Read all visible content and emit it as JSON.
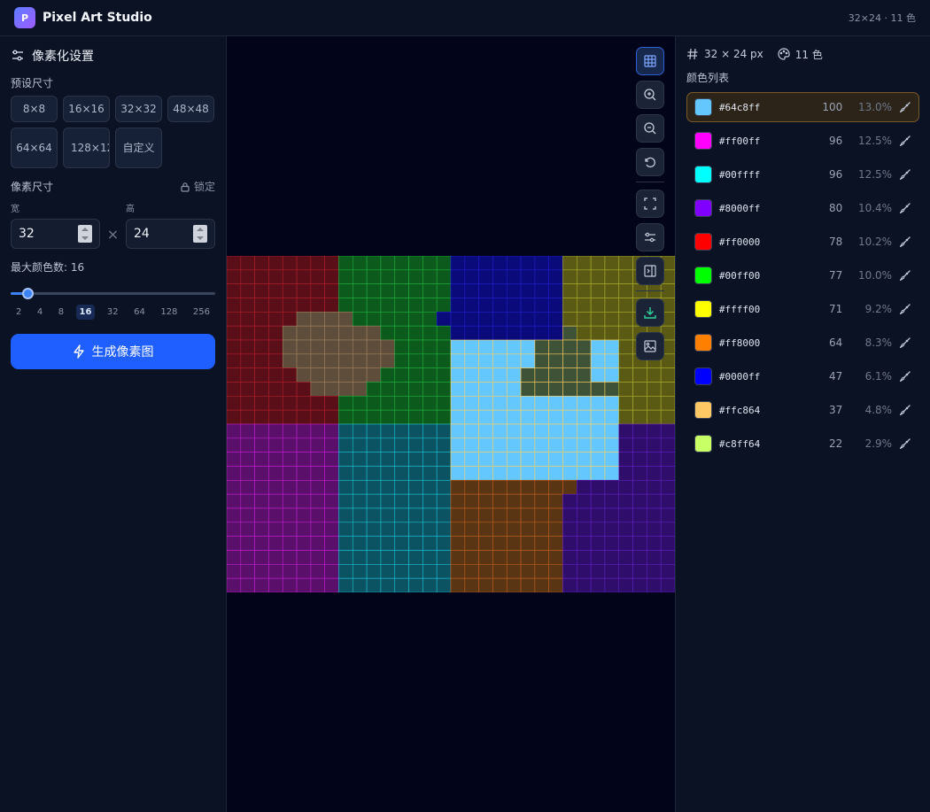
{
  "header": {
    "logo_letter": "P",
    "title": "Pixel Art Studio",
    "meta": "32×24 · 11 色"
  },
  "left": {
    "title": "像素化设置",
    "preset_label": "预设尺寸",
    "presets": [
      "8×8",
      "16×16",
      "32×32",
      "48×48",
      "64×64",
      "128×128",
      "自定义"
    ],
    "pixel_size_label": "像素尺寸",
    "lock_label": "锁定",
    "width_label": "宽",
    "height_label": "高",
    "width_value": "32",
    "height_value": "24",
    "times": "×",
    "max_colors_label": "最大颜色数: 16",
    "ticks": [
      "2",
      "4",
      "8",
      "16",
      "32",
      "64",
      "128",
      "256"
    ],
    "generate_label": "生成像素图"
  },
  "canvas": {
    "cols": 32,
    "rows": 24,
    "palette": {
      "r": "#5a0e18",
      "g": "#0c5a1c",
      "b": "#0a0a7a",
      "y": "#5a5a14",
      "m": "#5a0f6a",
      "c": "#0b5262",
      "o": "#5a3514",
      "p": "#2e0e6a",
      "k": "#5e4d3a",
      "l": "#64c8ff",
      "d": "#3e5238"
    },
    "grid_colors": {
      "r": "#b02030",
      "g": "#22b040",
      "b": "#2020c8",
      "y": "#b0b030",
      "m": "#c020d0",
      "c": "#20c0d0",
      "o": "#c06020",
      "p": "#6020c0",
      "k": "#a08060",
      "l": "#ffd060",
      "d": "#ffd060"
    },
    "rows_data": [
      "rrrrrrrrggggggggbbbbbbbbyyyyyyyy",
      "rrrrrrrrggggggggbbbbbbbbyyyyyyyy",
      "rrrrrrrrggggggggbbbbbbbbyyyyyyyy",
      "rrrrrrrrggggggggbbbbbbbbyyyyyyyy",
      "rrrrrkkkkggggggbbbbbbbbbyyyyyyyy",
      "rrrrkkkkkkkgggggbbbbbbbbdyyyyyyy",
      "rrrrkkkkkkkkggggllllllddddllyyyy",
      "rrrrkkkkkkkkggggllllllddddllyyyy",
      "rrrrrkkkkkkgggggllllldddddllyyyy",
      "rrrrrrkkkkggggggllllldddddddyyyy",
      "rrrrrrrrggggggggllllllllllllyyyy",
      "rrrrrrrrggggggggllllllllllllyyyy",
      "mmmmmmmmccccccccllllllllllllpppp",
      "mmmmmmmmccccccccllllllllllllpppp",
      "mmmmmmmmccccccccllllllllllllpppp",
      "mmmmmmmmccccccccllllllllllllpppp",
      "mmmmmmmmccccccccooooooooopppppppp",
      "mmmmmmmmccccccccoooooooopppppppp",
      "mmmmmmmmccccccccoooooooopppppppp",
      "mmmmmmmmccccccccoooooooopppppppp",
      "mmmmmmmmccccccccoooooooopppppppp",
      "mmmmmmmmccccccccoooooooopppppppp",
      "mmmmmmmmccccccccoooooooopppppppp",
      "mmmmmmmmccccccccoooooooopppppppp"
    ]
  },
  "right": {
    "size_stat": "32 × 24 px",
    "color_stat": "11 色",
    "list_title": "颜色列表",
    "colors": [
      {
        "hex": "#64c8ff",
        "count": "100",
        "pct": "13.0%"
      },
      {
        "hex": "#ff00ff",
        "count": "96",
        "pct": "12.5%"
      },
      {
        "hex": "#00ffff",
        "count": "96",
        "pct": "12.5%"
      },
      {
        "hex": "#8000ff",
        "count": "80",
        "pct": "10.4%"
      },
      {
        "hex": "#ff0000",
        "count": "78",
        "pct": "10.2%"
      },
      {
        "hex": "#00ff00",
        "count": "77",
        "pct": "10.0%"
      },
      {
        "hex": "#ffff00",
        "count": "71",
        "pct": "9.2%"
      },
      {
        "hex": "#ff8000",
        "count": "64",
        "pct": "8.3%"
      },
      {
        "hex": "#0000ff",
        "count": "47",
        "pct": "6.1%"
      },
      {
        "hex": "#ffc864",
        "count": "37",
        "pct": "4.8%"
      },
      {
        "hex": "#c8ff64",
        "count": "22",
        "pct": "2.9%"
      }
    ]
  }
}
